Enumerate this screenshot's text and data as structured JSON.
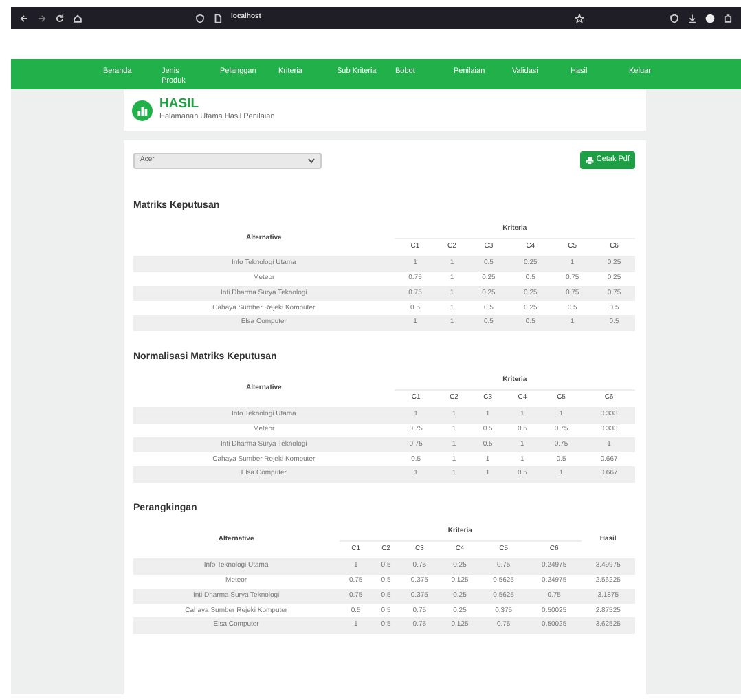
{
  "browser": {
    "url": "localhost"
  },
  "nav": [
    "Beranda",
    "Jenis Produk",
    "Pelanggan",
    "Kriteria",
    "Sub Kriteria",
    "Bobot",
    "Penilaian",
    "Validasi",
    "Hasil",
    "Keluar"
  ],
  "header": {
    "title": "HASIL",
    "subtitle": "Halamanan Utama Hasil Penilaian"
  },
  "filter": {
    "value": "Acer"
  },
  "print_button": "Cetak Pdf",
  "sections": [
    {
      "title": "Matriks Keputusan",
      "alt_header": "Alternative",
      "group_header": "Kriteria",
      "columns": [
        "C1",
        "C2",
        "C3",
        "C4",
        "C5",
        "C6"
      ],
      "rows": [
        {
          "name": "Info Teknologi Utama",
          "values": [
            "1",
            "1",
            "0.5",
            "0.25",
            "1",
            "0.25"
          ]
        },
        {
          "name": "Meteor",
          "values": [
            "0.75",
            "1",
            "0.25",
            "0.5",
            "0.75",
            "0.25"
          ]
        },
        {
          "name": "Inti Dharma Surya Teknologi",
          "values": [
            "0.75",
            "1",
            "0.25",
            "0.25",
            "0.75",
            "0.75"
          ]
        },
        {
          "name": "Cahaya Sumber Rejeki Komputer",
          "values": [
            "0.5",
            "1",
            "0.5",
            "0.25",
            "0.5",
            "0.5"
          ]
        },
        {
          "name": "Elsa Computer",
          "values": [
            "1",
            "1",
            "0.5",
            "0.5",
            "1",
            "0.5"
          ]
        }
      ]
    },
    {
      "title": "Normalisasi Matriks Keputusan",
      "alt_header": "Alternative",
      "group_header": "Kriteria",
      "columns": [
        "C1",
        "C2",
        "C3",
        "C4",
        "C5",
        "C6"
      ],
      "rows": [
        {
          "name": "Info Teknologi Utama",
          "values": [
            "1",
            "1",
            "1",
            "1",
            "1",
            "0.333"
          ]
        },
        {
          "name": "Meteor",
          "values": [
            "0.75",
            "1",
            "0.5",
            "0.5",
            "0.75",
            "0.333"
          ]
        },
        {
          "name": "Inti Dharma Surya Teknologi",
          "values": [
            "0.75",
            "1",
            "0.5",
            "1",
            "0.75",
            "1"
          ]
        },
        {
          "name": "Cahaya Sumber Rejeki Komputer",
          "values": [
            "0.5",
            "1",
            "1",
            "1",
            "0.5",
            "0.667"
          ]
        },
        {
          "name": "Elsa Computer",
          "values": [
            "1",
            "1",
            "1",
            "0.5",
            "1",
            "0.667"
          ]
        }
      ]
    },
    {
      "title": "Perangkingan",
      "alt_header": "Alternative",
      "group_header": "Kriteria",
      "result_header": "Hasil",
      "columns": [
        "C1",
        "C2",
        "C3",
        "C4",
        "C5",
        "C6"
      ],
      "rows": [
        {
          "name": "Info Teknologi Utama",
          "values": [
            "1",
            "0.5",
            "0.75",
            "0.25",
            "0.75",
            "0.24975"
          ],
          "result": "3.49975"
        },
        {
          "name": "Meteor",
          "values": [
            "0.75",
            "0.5",
            "0.375",
            "0.125",
            "0.5625",
            "0.24975"
          ],
          "result": "2.56225"
        },
        {
          "name": "Inti Dharma Surya Teknologi",
          "values": [
            "0.75",
            "0.5",
            "0.375",
            "0.25",
            "0.5625",
            "0.75"
          ],
          "result": "3.1875"
        },
        {
          "name": "Cahaya Sumber Rejeki Komputer",
          "values": [
            "0.5",
            "0.5",
            "0.75",
            "0.25",
            "0.375",
            "0.50025"
          ],
          "result": "2.87525"
        },
        {
          "name": "Elsa Computer",
          "values": [
            "1",
            "0.5",
            "0.75",
            "0.125",
            "0.75",
            "0.50025"
          ],
          "result": "3.62525"
        }
      ]
    }
  ]
}
